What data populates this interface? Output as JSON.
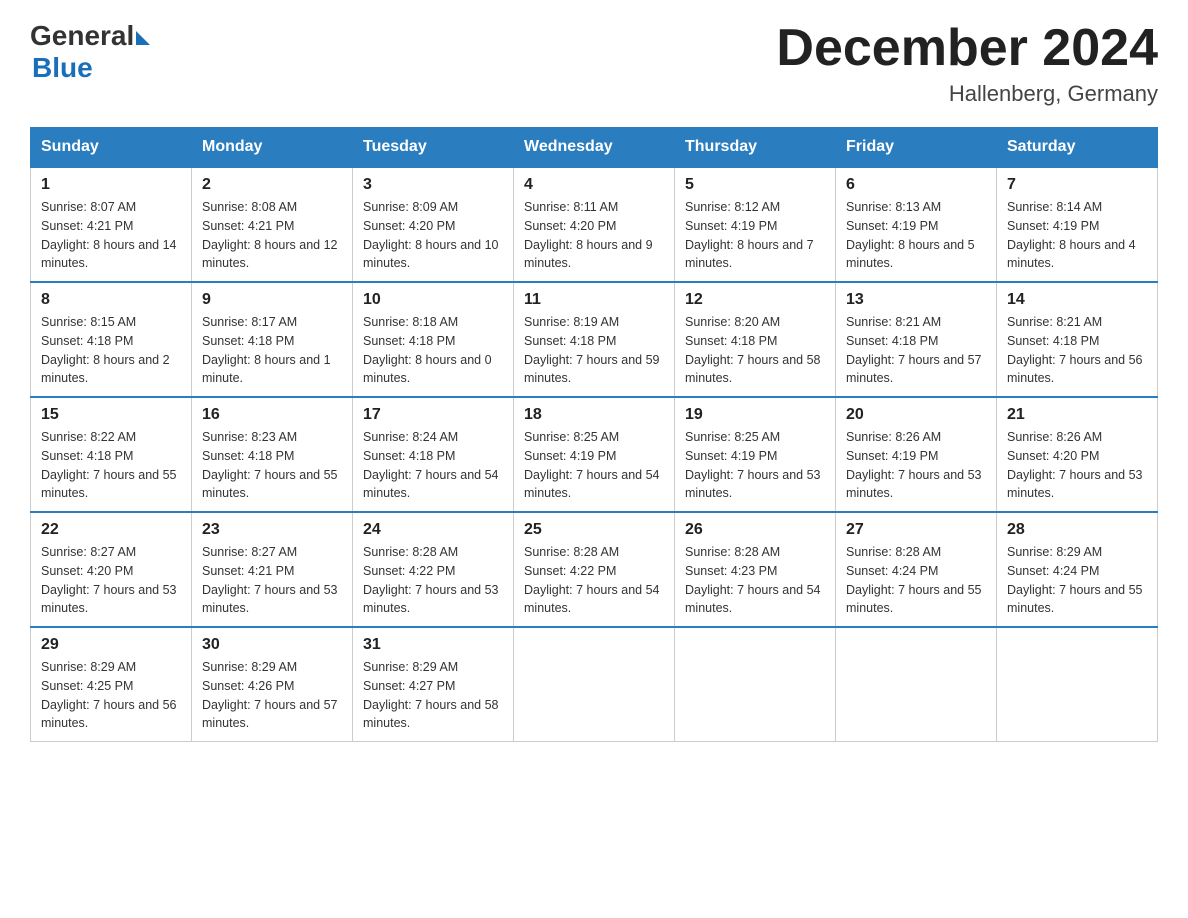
{
  "header": {
    "logo_general": "General",
    "logo_blue": "Blue",
    "month_title": "December 2024",
    "location": "Hallenberg, Germany"
  },
  "days_of_week": [
    "Sunday",
    "Monday",
    "Tuesday",
    "Wednesday",
    "Thursday",
    "Friday",
    "Saturday"
  ],
  "weeks": [
    [
      {
        "day": "1",
        "sunrise": "8:07 AM",
        "sunset": "4:21 PM",
        "daylight": "8 hours and 14 minutes."
      },
      {
        "day": "2",
        "sunrise": "8:08 AM",
        "sunset": "4:21 PM",
        "daylight": "8 hours and 12 minutes."
      },
      {
        "day": "3",
        "sunrise": "8:09 AM",
        "sunset": "4:20 PM",
        "daylight": "8 hours and 10 minutes."
      },
      {
        "day": "4",
        "sunrise": "8:11 AM",
        "sunset": "4:20 PM",
        "daylight": "8 hours and 9 minutes."
      },
      {
        "day": "5",
        "sunrise": "8:12 AM",
        "sunset": "4:19 PM",
        "daylight": "8 hours and 7 minutes."
      },
      {
        "day": "6",
        "sunrise": "8:13 AM",
        "sunset": "4:19 PM",
        "daylight": "8 hours and 5 minutes."
      },
      {
        "day": "7",
        "sunrise": "8:14 AM",
        "sunset": "4:19 PM",
        "daylight": "8 hours and 4 minutes."
      }
    ],
    [
      {
        "day": "8",
        "sunrise": "8:15 AM",
        "sunset": "4:18 PM",
        "daylight": "8 hours and 2 minutes."
      },
      {
        "day": "9",
        "sunrise": "8:17 AM",
        "sunset": "4:18 PM",
        "daylight": "8 hours and 1 minute."
      },
      {
        "day": "10",
        "sunrise": "8:18 AM",
        "sunset": "4:18 PM",
        "daylight": "8 hours and 0 minutes."
      },
      {
        "day": "11",
        "sunrise": "8:19 AM",
        "sunset": "4:18 PM",
        "daylight": "7 hours and 59 minutes."
      },
      {
        "day": "12",
        "sunrise": "8:20 AM",
        "sunset": "4:18 PM",
        "daylight": "7 hours and 58 minutes."
      },
      {
        "day": "13",
        "sunrise": "8:21 AM",
        "sunset": "4:18 PM",
        "daylight": "7 hours and 57 minutes."
      },
      {
        "day": "14",
        "sunrise": "8:21 AM",
        "sunset": "4:18 PM",
        "daylight": "7 hours and 56 minutes."
      }
    ],
    [
      {
        "day": "15",
        "sunrise": "8:22 AM",
        "sunset": "4:18 PM",
        "daylight": "7 hours and 55 minutes."
      },
      {
        "day": "16",
        "sunrise": "8:23 AM",
        "sunset": "4:18 PM",
        "daylight": "7 hours and 55 minutes."
      },
      {
        "day": "17",
        "sunrise": "8:24 AM",
        "sunset": "4:18 PM",
        "daylight": "7 hours and 54 minutes."
      },
      {
        "day": "18",
        "sunrise": "8:25 AM",
        "sunset": "4:19 PM",
        "daylight": "7 hours and 54 minutes."
      },
      {
        "day": "19",
        "sunrise": "8:25 AM",
        "sunset": "4:19 PM",
        "daylight": "7 hours and 53 minutes."
      },
      {
        "day": "20",
        "sunrise": "8:26 AM",
        "sunset": "4:19 PM",
        "daylight": "7 hours and 53 minutes."
      },
      {
        "day": "21",
        "sunrise": "8:26 AM",
        "sunset": "4:20 PM",
        "daylight": "7 hours and 53 minutes."
      }
    ],
    [
      {
        "day": "22",
        "sunrise": "8:27 AM",
        "sunset": "4:20 PM",
        "daylight": "7 hours and 53 minutes."
      },
      {
        "day": "23",
        "sunrise": "8:27 AM",
        "sunset": "4:21 PM",
        "daylight": "7 hours and 53 minutes."
      },
      {
        "day": "24",
        "sunrise": "8:28 AM",
        "sunset": "4:22 PM",
        "daylight": "7 hours and 53 minutes."
      },
      {
        "day": "25",
        "sunrise": "8:28 AM",
        "sunset": "4:22 PM",
        "daylight": "7 hours and 54 minutes."
      },
      {
        "day": "26",
        "sunrise": "8:28 AM",
        "sunset": "4:23 PM",
        "daylight": "7 hours and 54 minutes."
      },
      {
        "day": "27",
        "sunrise": "8:28 AM",
        "sunset": "4:24 PM",
        "daylight": "7 hours and 55 minutes."
      },
      {
        "day": "28",
        "sunrise": "8:29 AM",
        "sunset": "4:24 PM",
        "daylight": "7 hours and 55 minutes."
      }
    ],
    [
      {
        "day": "29",
        "sunrise": "8:29 AM",
        "sunset": "4:25 PM",
        "daylight": "7 hours and 56 minutes."
      },
      {
        "day": "30",
        "sunrise": "8:29 AM",
        "sunset": "4:26 PM",
        "daylight": "7 hours and 57 minutes."
      },
      {
        "day": "31",
        "sunrise": "8:29 AM",
        "sunset": "4:27 PM",
        "daylight": "7 hours and 58 minutes."
      },
      null,
      null,
      null,
      null
    ]
  ]
}
